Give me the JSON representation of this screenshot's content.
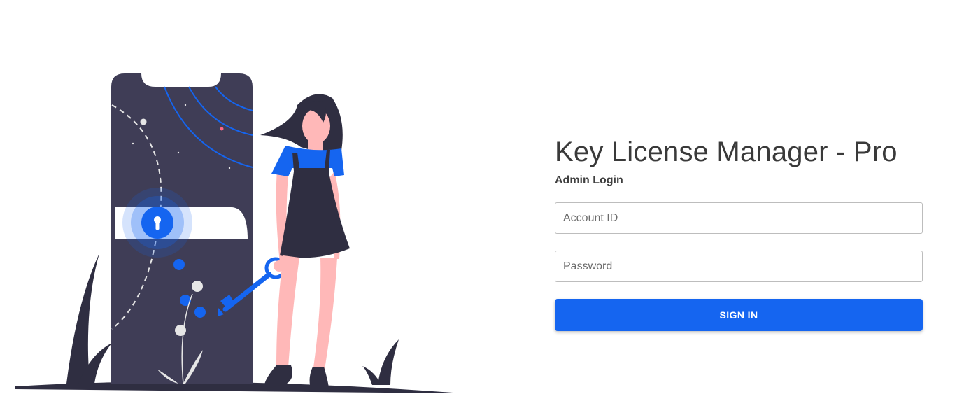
{
  "app": {
    "title": "Key License Manager - Pro",
    "subtitle": "Admin Login"
  },
  "form": {
    "account_placeholder": "Account ID",
    "account_value": "",
    "password_placeholder": "Password",
    "password_value": "",
    "submit_label": "SIGN IN"
  },
  "illustration": {
    "description_icon": "woman-with-key-and-phone-lock-illustration"
  },
  "colors": {
    "accent": "#1565f0",
    "dark": "#3f3d56",
    "skin": "#ffb8b8",
    "hair": "#2f2e41",
    "background": "#ffffff"
  }
}
